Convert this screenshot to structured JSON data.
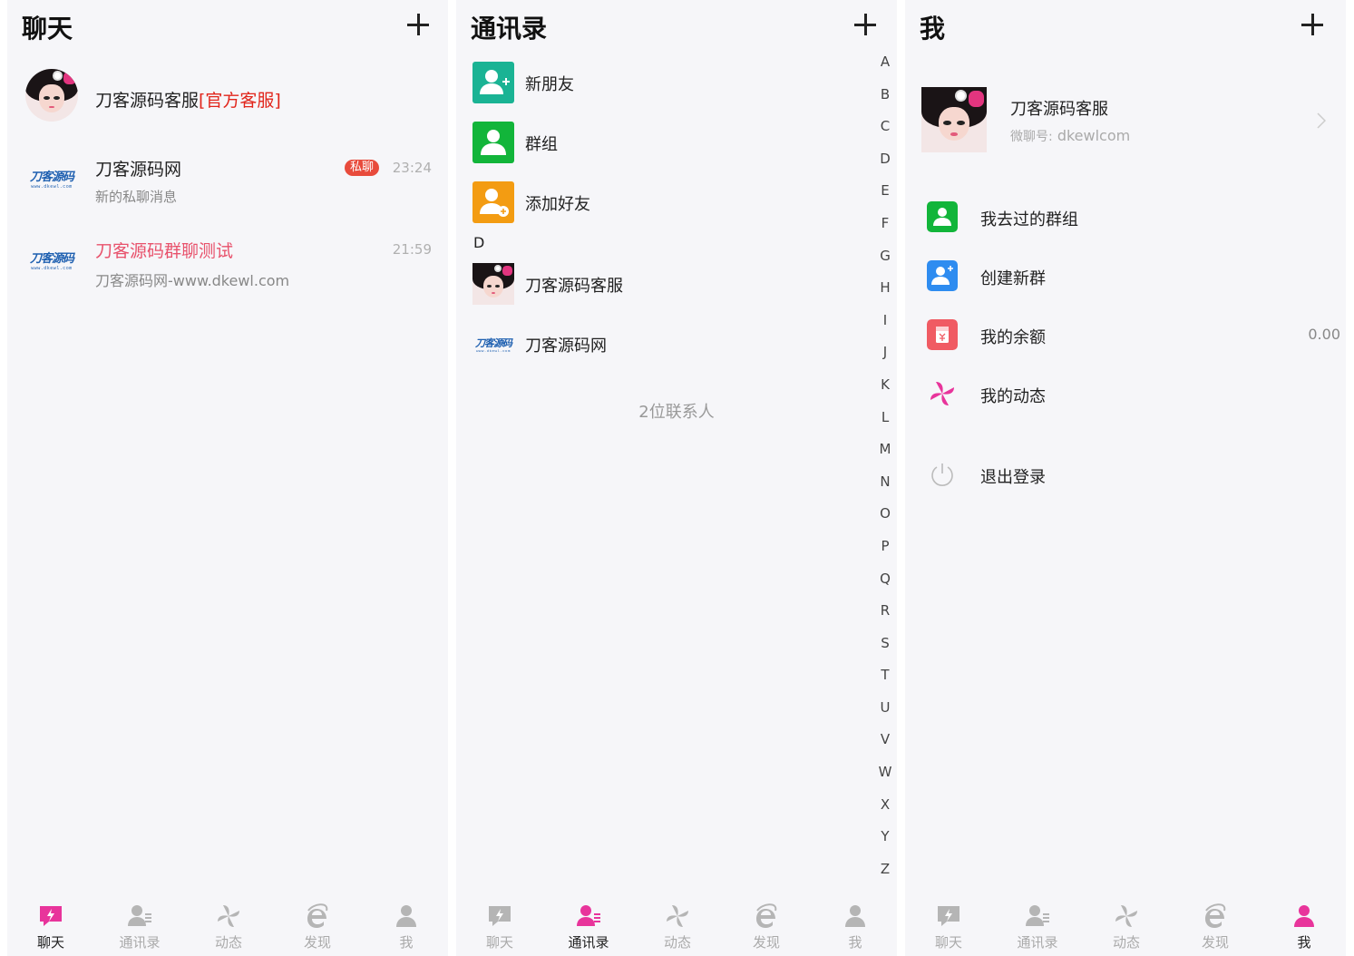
{
  "colors": {
    "accent": "#e8349b",
    "green": "#12b53a",
    "teal": "#1ab394",
    "orange": "#f39c12",
    "blue": "#2e8cf0",
    "red_tag": "#e1251b"
  },
  "chat_panel": {
    "title": "聊天",
    "items": [
      {
        "name": "刀客源码客服",
        "tag": "[官方客服]",
        "avatar": "girl-avatar"
      },
      {
        "name": "刀客源码网",
        "badge": "私聊",
        "time": "23:24",
        "preview": "新的私聊消息",
        "avatar": "dkewl-logo"
      },
      {
        "name": "刀客源码群聊测试",
        "time": "21:59",
        "preview": "刀客源码网-www.dkewl.com",
        "avatar": "dkewl-logo"
      }
    ]
  },
  "contacts_panel": {
    "title": "通讯录",
    "shortcuts": [
      {
        "label": "新朋友",
        "icon": "new-friend-icon"
      },
      {
        "label": "群组",
        "icon": "group-icon"
      },
      {
        "label": "添加好友",
        "icon": "add-friend-icon"
      }
    ],
    "section": "D",
    "contacts": [
      {
        "label": "刀客源码客服",
        "avatar": "girl-avatar"
      },
      {
        "label": "刀客源码网",
        "avatar": "dkewl-logo"
      }
    ],
    "count_text": "2位联系人",
    "index_letters": [
      "A",
      "B",
      "C",
      "D",
      "E",
      "F",
      "G",
      "H",
      "I",
      "J",
      "K",
      "L",
      "M",
      "N",
      "O",
      "P",
      "Q",
      "R",
      "S",
      "T",
      "U",
      "V",
      "W",
      "X",
      "Y",
      "Z"
    ]
  },
  "me_panel": {
    "title": "我",
    "profile": {
      "name": "刀客源码客服",
      "id_label": "微聊号:",
      "id_value": "dkewlcom"
    },
    "menu": [
      {
        "label": "我去过的群组",
        "icon": "group-visited-icon"
      },
      {
        "label": "创建新群",
        "icon": "create-group-icon"
      },
      {
        "label": "我的余额",
        "icon": "wallet-icon",
        "value": "0.00"
      },
      {
        "label": "我的动态",
        "icon": "pinwheel-icon"
      }
    ],
    "logout": "退出登录"
  },
  "logo_text": {
    "main": "刀客源码",
    "sub": "www.dkewl.com"
  },
  "tabbar": {
    "labels": [
      "聊天",
      "通讯录",
      "动态",
      "发现",
      "我"
    ]
  }
}
